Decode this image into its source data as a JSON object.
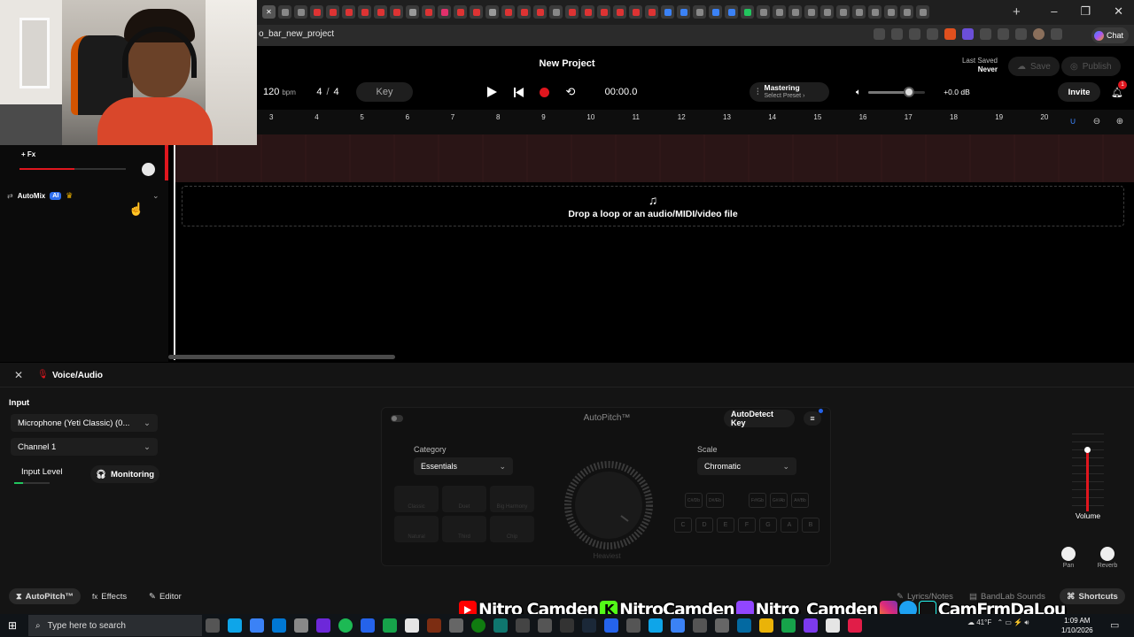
{
  "browser": {
    "url": "bandlab.com/studio?context=bar_new_project",
    "url_visible": "o_bar_new_project",
    "chat_label": "Chat",
    "new_tab": "+",
    "window_controls": [
      "–",
      "❐",
      "✕"
    ]
  },
  "header": {
    "title": "New Project",
    "last_saved_label": "Last Saved",
    "last_saved_value": "Never",
    "save_label": "Save",
    "publish_label": "Publish",
    "invite_label": "Invite",
    "notification_count": "1"
  },
  "transport": {
    "tempo": "120",
    "tempo_unit": "bpm",
    "time_sig_top": "4",
    "time_sig_sep": "/",
    "time_sig_bottom": "4",
    "key_label": "Key",
    "time": "00:00.0",
    "mastering_label": "Mastering",
    "mastering_preset": "Select Preset ›",
    "master_volume_db": "+0.0 dB",
    "master_volume_level": 0.72
  },
  "ruler": {
    "ticks": [
      "3",
      "4",
      "5",
      "6",
      "7",
      "8",
      "9",
      "10",
      "11",
      "12",
      "13",
      "14",
      "15",
      "16",
      "17",
      "18",
      "19",
      "20"
    ]
  },
  "track": {
    "fx_label": "+ Fx",
    "automix_label": "AutoMix",
    "automix_badge": "AI",
    "volume_level": 0.52
  },
  "dropzone": {
    "label": "Drop a loop or an audio/MIDI/video file"
  },
  "editor": {
    "track_name": "Voice/Audio",
    "input_heading": "Input",
    "input_device": "Microphone (Yeti Classic) (0...",
    "channel": "Channel 1",
    "input_level_label": "Input Level",
    "monitoring_label": "Monitoring",
    "autopitch": {
      "title": "AutoPitch™",
      "autodetect_label": "AutoDetect Key",
      "category_label": "Category",
      "category_value": "Essentials",
      "scale_label": "Scale",
      "scale_value": "Chromatic",
      "knob_label": "Heaviest",
      "effects": [
        "Classic",
        "Duet",
        "Big Harmony",
        "Natural",
        "Third",
        "Chip"
      ],
      "keys_sharp": [
        "C#/Db",
        "D#/Eb",
        "F#/Gb",
        "G#/Ab",
        "A#/Bb"
      ],
      "keys_natural": [
        "C",
        "D",
        "E",
        "F",
        "G",
        "A",
        "B"
      ]
    },
    "volume_label": "Volume",
    "pan_label": "Pan",
    "reverb_label": "Reverb"
  },
  "footer": {
    "tabs": [
      "AutoPitch™",
      "Effects",
      "Editor"
    ],
    "lyrics_label": "Lyrics/Notes",
    "sounds_label": "BandLab Sounds",
    "shortcuts_label": "Shortcuts"
  },
  "socials": {
    "youtube": "Nitro Camden",
    "kick": "NitroCamden",
    "twitch": "Nitro_Camden",
    "others": "CamFrmDaLou"
  },
  "taskbar": {
    "search_placeholder": "Type here to search",
    "temperature": "41°F",
    "time": "1:09 AM",
    "date": "1/10/2026"
  },
  "colors": {
    "accent_blue": "#2563eb",
    "record_red": "#e0161e",
    "track_strip": "#2a1516",
    "ai_badge": "#2f6fed"
  }
}
